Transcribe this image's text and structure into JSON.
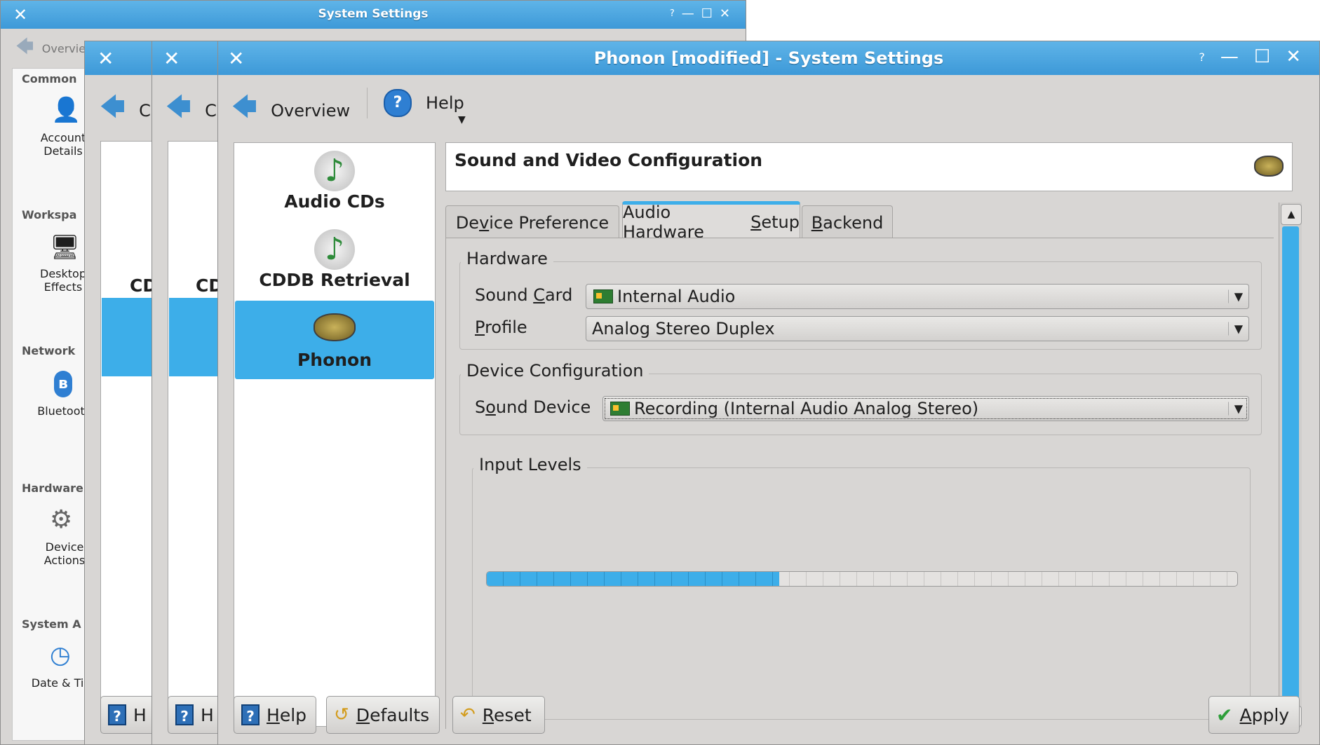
{
  "back_window": {
    "title": "System Settings",
    "overview_label": "Overvie",
    "categories": [
      {
        "label": "Common",
        "item": "Account Details"
      },
      {
        "label": "Workspa",
        "item": "Desktop Effects"
      },
      {
        "label": "Network",
        "item": "Bluetoot"
      },
      {
        "label": "Hardware",
        "item": "Device Actions"
      },
      {
        "label": "System A",
        "item": "Date & Ti"
      }
    ]
  },
  "mid_windows": {
    "overview_fragment": "C",
    "module_fragment": "CD",
    "help_fragment": "H"
  },
  "front_window": {
    "title": "Phonon [modified] - System Settings",
    "toolbar": {
      "overview": "Overview",
      "help": "Help"
    },
    "modules": [
      {
        "label": "Audio CDs",
        "icon": "music-note-icon",
        "selected": false
      },
      {
        "label": "CDDB Retrieval",
        "icon": "music-note-icon",
        "selected": false
      },
      {
        "label": "Phonon",
        "icon": "speaker-icon",
        "selected": true
      }
    ],
    "header_title": "Sound and Video Configuration",
    "tabs": [
      {
        "pre": "De",
        "ul": "v",
        "post": "ice Preference",
        "active": false
      },
      {
        "pre": "Audio Hardware ",
        "ul": "S",
        "post": "etup",
        "active": true
      },
      {
        "pre": "",
        "ul": "B",
        "post": "ackend",
        "active": false
      }
    ],
    "hardware_group": {
      "title": "Hardware",
      "sound_card": {
        "pre": "Sound ",
        "ul": "C",
        "post": "ard",
        "value": "Internal Audio"
      },
      "profile": {
        "pre": "",
        "ul": "P",
        "post": "rofile",
        "value": "Analog Stereo Duplex"
      }
    },
    "device_group": {
      "title": "Device Configuration",
      "sound_device": {
        "pre": "S",
        "ul": "o",
        "post": "und Device",
        "value": "Recording (Internal Audio Analog Stereo)"
      }
    },
    "input_levels": {
      "title": "Input Levels",
      "level": 0.39
    },
    "buttons": {
      "help": {
        "pre": "",
        "ul": "H",
        "post": "elp"
      },
      "defaults": {
        "pre": "",
        "ul": "D",
        "post": "efaults"
      },
      "reset": {
        "pre": "",
        "ul": "R",
        "post": "eset"
      },
      "apply": {
        "pre": "",
        "ul": "A",
        "post": "pply"
      }
    },
    "accent_color": "#3daee9"
  }
}
